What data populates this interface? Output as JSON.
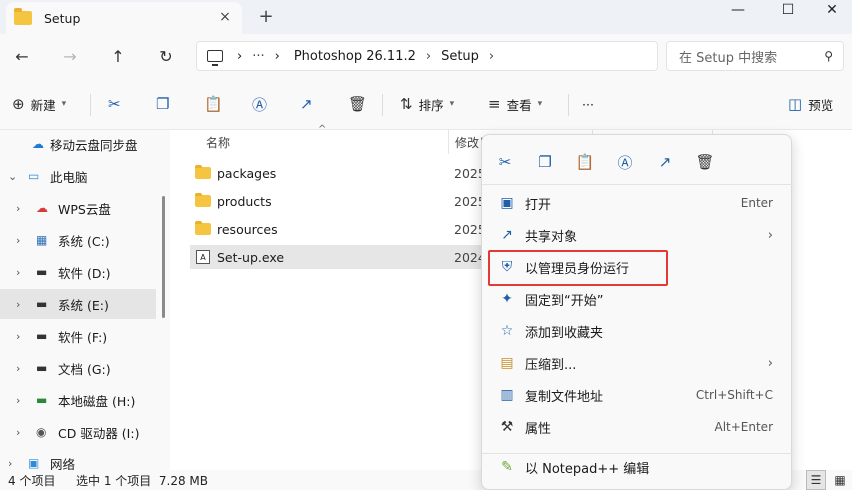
{
  "window": {
    "tab_title": "Setup",
    "tab_close": "×",
    "new_tab": "+",
    "min": "—",
    "max": "☐",
    "close": "✕"
  },
  "nav": {
    "back": "←",
    "forward": "→",
    "up": "↑",
    "refresh": "↻",
    "more": "···",
    "breadcrumb": [
      "Photoshop 26.11.2",
      "Setup"
    ],
    "search_placeholder": "在 Setup 中搜索"
  },
  "toolbar": {
    "new_label": "新建",
    "sort_label": "排序",
    "view_label": "查看",
    "more": "···",
    "preview_label": "预览"
  },
  "sidebar": {
    "items": [
      {
        "label": "移动云盘同步盘",
        "icon": "cloud-sync-icon",
        "glyph": "☁"
      },
      {
        "label": "此电脑",
        "icon": "computer-icon",
        "glyph": "▭"
      },
      {
        "label": "WPS云盘",
        "icon": "wps-cloud-icon",
        "glyph": "☁"
      },
      {
        "label": "系统 (C:)",
        "icon": "windows-drive-icon",
        "glyph": "▦"
      },
      {
        "label": "软件 (D:)",
        "icon": "drive-icon",
        "glyph": "▬"
      },
      {
        "label": "系统 (E:)",
        "icon": "drive-icon",
        "glyph": "▬"
      },
      {
        "label": "软件 (F:)",
        "icon": "drive-icon",
        "glyph": "▬"
      },
      {
        "label": "文档 (G:)",
        "icon": "drive-icon",
        "glyph": "▬"
      },
      {
        "label": "本地磁盘 (H:)",
        "icon": "drive-icon",
        "glyph": "▬"
      },
      {
        "label": "CD 驱动器 (I:)",
        "icon": "cd-drive-icon",
        "glyph": "◉"
      },
      {
        "label": "网络",
        "icon": "network-icon",
        "glyph": "▣"
      }
    ]
  },
  "files": {
    "col_name": "名称",
    "col_date": "修改日",
    "rows": [
      {
        "name": "packages",
        "date": "2025",
        "type": "folder"
      },
      {
        "name": "products",
        "date": "2025",
        "type": "folder"
      },
      {
        "name": "resources",
        "date": "2025",
        "type": "folder"
      },
      {
        "name": "Set-up.exe",
        "date": "2024",
        "type": "exe"
      }
    ]
  },
  "status": {
    "count": "4 个项目",
    "selected": "选中 1 个项目  7.28 MB"
  },
  "context_menu": {
    "items": [
      {
        "label": "打开",
        "key": "Enter",
        "icon": "open-icon",
        "glyph": "▣"
      },
      {
        "label": "共享对象",
        "key": "",
        "arrow": "›",
        "icon": "share-icon",
        "glyph": "↗"
      },
      {
        "label": "以管理员身份运行",
        "key": "",
        "icon": "shield-icon",
        "glyph": "⛨"
      },
      {
        "label": "固定到“开始”",
        "key": "",
        "icon": "pin-icon",
        "glyph": "✦"
      },
      {
        "label": "添加到收藏夹",
        "key": "",
        "icon": "star-icon",
        "glyph": "☆"
      },
      {
        "label": "压缩到...",
        "key": "",
        "arrow": "›",
        "icon": "zip-icon",
        "glyph": "▤"
      },
      {
        "label": "复制文件地址",
        "key": "Ctrl+Shift+C",
        "icon": "copy-path-icon",
        "glyph": "▥"
      },
      {
        "label": "属性",
        "key": "Alt+Enter",
        "icon": "wrench-icon",
        "glyph": "⚒"
      },
      {
        "label": "以 Notepad++ 编辑",
        "key": "",
        "icon": "notepad-icon",
        "glyph": "✎"
      }
    ]
  },
  "colors": {
    "accent": "#1f5fa8",
    "highlight": "#e53935",
    "folder": "#f5c542"
  }
}
